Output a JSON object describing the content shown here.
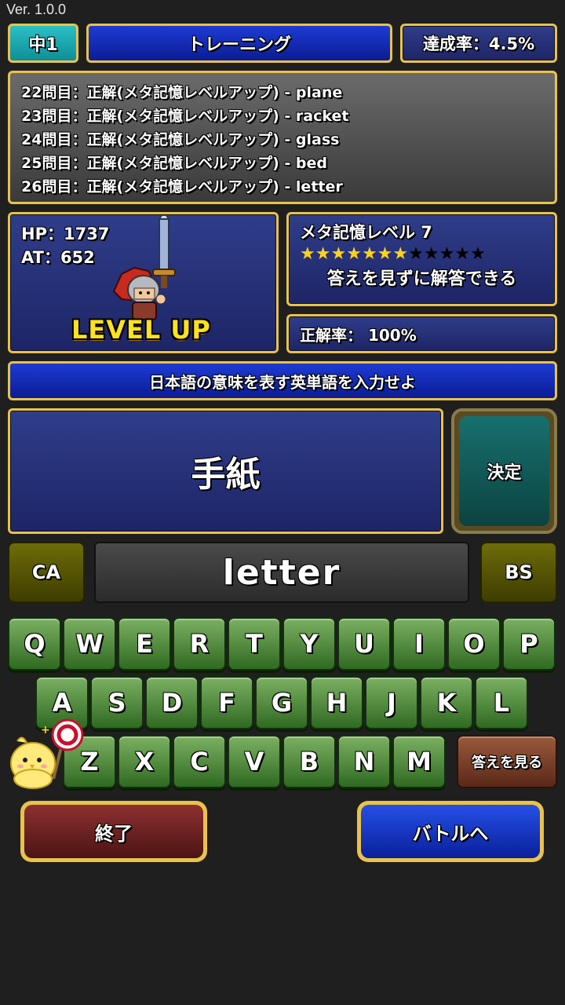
{
  "version": "Ver. 1.0.0",
  "header": {
    "grade": "中1",
    "mode": "トレーニング",
    "achievement": "達成率：4.5%"
  },
  "log": [
    "22問目：正解(メタ記憶レベルアップ) - plane",
    "23問目：正解(メタ記憶レベルアップ) - racket",
    "24問目：正解(メタ記憶レベルアップ) - glass",
    "25問目：正解(メタ記憶レベルアップ) - bed",
    "26問目：正解(メタ記憶レベルアップ) - letter"
  ],
  "status": {
    "hp": "HP：1737",
    "at": "AT：652",
    "level_up": "LEVEL UP"
  },
  "meta_memory": {
    "title": "メタ記憶レベル 7",
    "level": 7,
    "max_level": 12,
    "description": "答えを見ずに解答できる"
  },
  "accuracy": "正解率： 100%",
  "instruction": "日本語の意味を表す英単語を入力せよ",
  "question": "手紙",
  "decide_label": "決定",
  "clear_label": "CA",
  "backspace_label": "BS",
  "answer_value": "letter",
  "keyboard": {
    "row1": [
      "Q",
      "W",
      "E",
      "R",
      "T",
      "Y",
      "U",
      "I",
      "O",
      "P"
    ],
    "row2": [
      "A",
      "S",
      "D",
      "F",
      "G",
      "H",
      "J",
      "K",
      "L"
    ],
    "row3": [
      "Z",
      "X",
      "C",
      "V",
      "B",
      "N",
      "M"
    ]
  },
  "show_answer_label": "答えを見る",
  "end_label": "終了",
  "battle_label": "バトルへ",
  "colors": {
    "frame_gold": "#e9c24a",
    "panel_navy": "#1e2566",
    "key_green": "#4f8c3a",
    "star_yellow": "#ffd21a"
  }
}
